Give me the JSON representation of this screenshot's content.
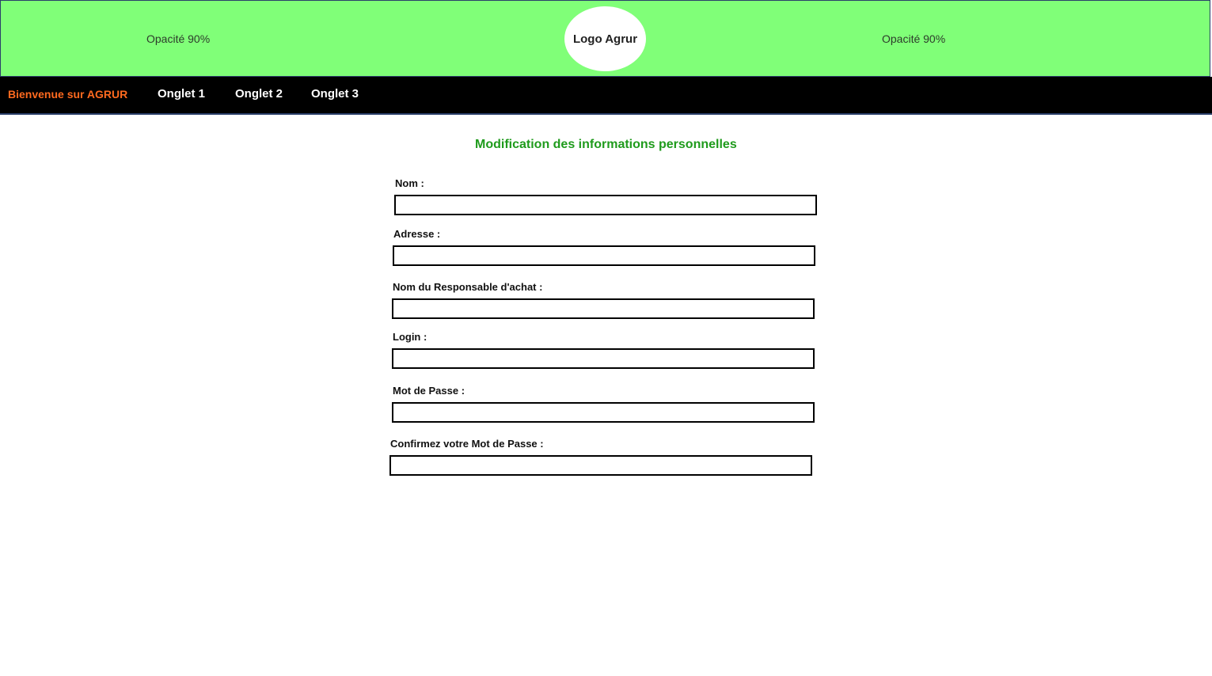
{
  "header": {
    "opacity_left": "Opacité 90%",
    "logo_text": "Logo Agrur",
    "opacity_right": "Opacité 90%",
    "background_color": "#80ff78"
  },
  "nav": {
    "welcome": "Bienvenue sur AGRUR",
    "tabs": [
      {
        "label": "Onglet 1"
      },
      {
        "label": "Onglet 2"
      },
      {
        "label": "Onglet 3"
      }
    ],
    "background_color": "#000000",
    "welcome_color": "#ff6a1f"
  },
  "form": {
    "title": "Modification des informations personnelles",
    "title_color": "#1f9b1c",
    "fields": [
      {
        "label": "Nom :",
        "value": ""
      },
      {
        "label": "Adresse :",
        "value": ""
      },
      {
        "label": "Nom du Responsable d'achat :",
        "value": ""
      },
      {
        "label": "Login :",
        "value": ""
      },
      {
        "label": "Mot de Passe :",
        "value": ""
      },
      {
        "label": "Confirmez votre Mot de Passe :",
        "value": ""
      }
    ]
  }
}
